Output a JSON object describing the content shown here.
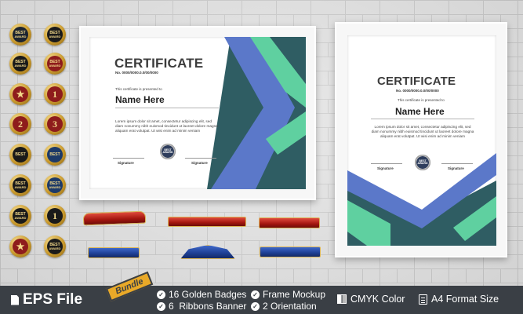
{
  "badges": [
    {
      "icon": "best-award-badge-icon",
      "line1": "BEST",
      "line2": "AWARD",
      "style": "dark"
    },
    {
      "icon": "best-award-badge-icon",
      "line1": "BEST",
      "line2": "AWARD",
      "style": "black"
    },
    {
      "icon": "best-award-badge-icon",
      "line1": "BEST",
      "line2": "AWARD",
      "style": "black"
    },
    {
      "icon": "best-award-badge-icon",
      "line1": "BEST",
      "line2": "AWARD",
      "style": "red"
    },
    {
      "icon": "star-badge-icon",
      "text": "★",
      "style": "red"
    },
    {
      "icon": "number-one-badge-icon",
      "text": "1",
      "style": "red"
    },
    {
      "icon": "number-two-badge-icon",
      "text": "2",
      "style": "red"
    },
    {
      "icon": "number-three-badge-icon",
      "text": "3",
      "style": "red"
    },
    {
      "icon": "best-badge-icon",
      "line1": "BEST",
      "line2": "",
      "style": "black"
    },
    {
      "icon": "best-badge-icon",
      "line1": "BEST",
      "line2": "",
      "style": "navy"
    },
    {
      "icon": "best-award-badge-icon",
      "line1": "BEST",
      "line2": "AWARD",
      "style": "black"
    },
    {
      "icon": "best-award-badge-icon",
      "line1": "BEST",
      "line2": "AWARD",
      "style": "navy"
    },
    {
      "icon": "best-award-badge-icon",
      "line1": "BEST",
      "line2": "AWARD",
      "style": "black"
    },
    {
      "icon": "number-one-badge-icon",
      "text": "1",
      "style": "black"
    },
    {
      "icon": "star-badge-icon",
      "text": "★",
      "style": "red"
    },
    {
      "icon": "best-award-badge-icon",
      "line1": "BEST",
      "line2": "AWARD",
      "style": "black"
    }
  ],
  "certificate_landscape": {
    "title": "CERTIFICATE",
    "number": "No. 0000/0000.0.0/00/0000",
    "presented": "This certificate is presented to",
    "name": "Name Here",
    "lorem": "Lorem ipsum dolor sit amet, consectetur adipiscing elit, sed diam nonummy nibh euismod tincidunt ut laoreet dolore magna aliquam erat volutpat. Ut wisi enim ad minim veniam",
    "signature_left": "Signature",
    "signature_right": "Signature",
    "seal_line1": "BEST",
    "seal_line2": "AWARD"
  },
  "certificate_portrait": {
    "title": "CERTIFICATE",
    "number": "No. 0000/0000.0.0/00/0000",
    "presented": "This certificate is presented to",
    "name": "Name Here",
    "lorem": "Lorem ipsum dolor sit amet, consectetur adipiscing elit, sed diam nonummy nibh euismod tincidunt ut laoreet dolore magna aliquam erat volutpat. Ut wisi enim ad minim veniam",
    "signature_left": "Signature",
    "signature_right": "Signature",
    "seal_line1": "BEST",
    "seal_line2": "AWARD"
  },
  "colors": {
    "navy": "#2f5d63",
    "periwinkle": "#5b78c9",
    "mint": "#5fd0a0",
    "bar": "#3a3f45",
    "bundle": "#e9a928"
  },
  "footer": {
    "eps_label": "EPS File",
    "bundle_label": "Bundle",
    "feature_1": "16 Golden Badges",
    "feature_2": "6  Ribbons Banner",
    "feature_3": "Frame Mockup",
    "feature_4": "2 Orientation",
    "cmyk_label": "CMYK Color",
    "a4_label": "A4 Format Size"
  }
}
